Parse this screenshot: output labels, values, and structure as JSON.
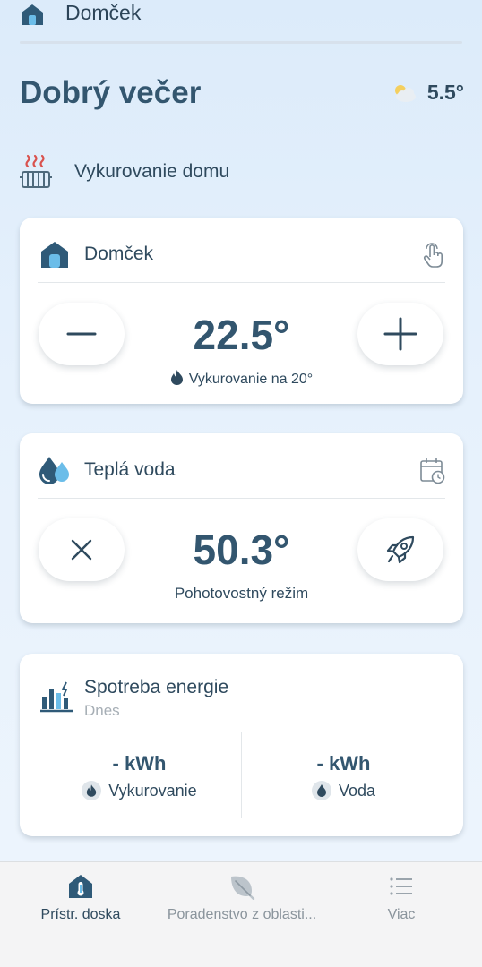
{
  "header": {
    "home_name": "Domček"
  },
  "greeting": "Dobrý večer",
  "weather": {
    "icon": "partly-cloudy-night-icon",
    "temperature": "5.5°"
  },
  "section": {
    "icon": "radiator-icon",
    "label": "Vykurovanie domu"
  },
  "heating_card": {
    "name": "Domček",
    "current_temperature": "22.5°",
    "status": "Vykurovanie na 20°",
    "decrease_icon": "minus-icon",
    "increase_icon": "plus-icon",
    "manual_icon": "touch-hand-icon"
  },
  "water_card": {
    "name": "Teplá voda",
    "current_temperature": "50.3°",
    "status": "Pohotovostný režim",
    "off_icon": "close-icon",
    "boost_icon": "rocket-icon",
    "schedule_icon": "calendar-clock-icon"
  },
  "energy_card": {
    "title": "Spotreba energie",
    "period": "Dnes",
    "heating": {
      "value": "- kWh",
      "label": "Vykurovanie"
    },
    "water": {
      "value": "- kWh",
      "label": "Voda"
    }
  },
  "nav": {
    "items": [
      {
        "label": "Prístr. doska",
        "icon": "dashboard-thermometer-icon",
        "active": true
      },
      {
        "label": "Poradenstvo z oblasti...",
        "icon": "leaf-icon",
        "active": false
      },
      {
        "label": "Viac",
        "icon": "list-icon",
        "active": false
      }
    ]
  },
  "colors": {
    "primary": "#2f5a78",
    "accent_blue": "#5ab4e6",
    "background": "#e2eefb"
  }
}
